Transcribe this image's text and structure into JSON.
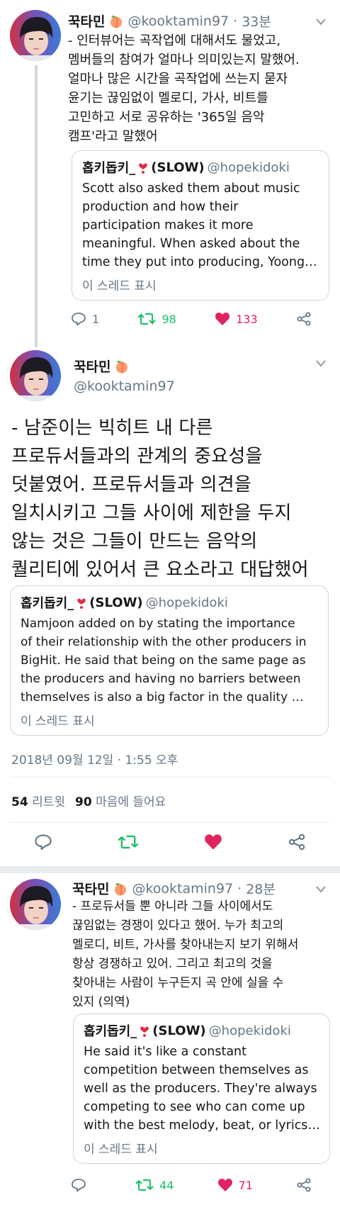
{
  "tweets": [
    {
      "name": "꾹타민",
      "handle": "@kooktamin97",
      "time": "33분",
      "text": "- 인터뷰어는 곡작업에 대해서도 물었고,\n멤버들의 참여가 얼마나 의미있는지 말했어.\n얼마나 많은 시간을 곡작업에 쓰는지 묻자\n윤기는 끊임없이 멜로디, 가사, 비트를\n고민하고 서로 공유하는 '365일 음악\n캠프'라고 말했어",
      "quote": {
        "name": "홉키돕키_",
        "name_suffix": "(SLOW)",
        "handle": "@hopekidoki",
        "lines": [
          "Scott also asked them about music",
          "production and how their",
          "participation makes it more",
          "meaningful. When asked about the",
          "time they put into producing, Yoongi…"
        ],
        "link": "이 스레드 표시"
      },
      "replies": "1",
      "retweets": "98",
      "likes": "133"
    },
    {
      "name": "꾹타민",
      "handle": "@kooktamin97",
      "text": "- 남준이는 빅히트 내 다른\n프로듀서들과의 관계의 중요성을\n덧붙였어. 프로듀서들과 의견을\n일치시키고 그들 사이에 제한을 두지\n않는 것은 그들이 만드는 음악의\n퀄리티에 있어서 큰 요소라고 대답했어",
      "quote": {
        "name": "홉키돕키_",
        "name_suffix": "(SLOW)",
        "handle": "@hopekidoki",
        "lines": [
          "Namjoon added on by stating the importance",
          "of their relationship with the other producers in",
          "BigHit. He said that being on the same page as",
          "the producers and having no barriers between",
          "themselves is also a big factor in the quality …"
        ],
        "link": "이 스레드 표시"
      },
      "timestamp": "2018년 09월 12일 · 1:55 오후",
      "retweet_count": "54",
      "retweet_label": "리트윗",
      "like_count": "90",
      "like_label": "마음에 들어요"
    },
    {
      "name": "꾹타민",
      "handle": "@kooktamin97",
      "time": "28분",
      "text": "- 프로듀서들 뿐 아니라 그들 사이에서도\n끊임없는 경쟁이 있다고 했어. 누가 최고의\n멜로디, 비트, 가사를 찾아내는지 보기 위해서\n항상 경쟁하고 있어. 그리고 최고의 것을\n찾아내는 사람이 누구든지 곡 안에 실을 수\n있지 (의역)",
      "quote": {
        "name": "홉키돕키_",
        "name_suffix": "(SLOW)",
        "handle": "@hopekidoki",
        "lines": [
          "He said it's like a constant",
          "competition between themselves as",
          "well as the producers. They're always",
          "competing to see who can come up",
          "with the best melody, beat, or lyrics,…"
        ],
        "link": "이 스레드 표시"
      },
      "replies": "",
      "retweets": "44",
      "likes": "71"
    }
  ],
  "colors": {
    "retweet": "#17bf63",
    "like": "#e0245e",
    "muted": "#657786",
    "border": "#ccd6dd"
  },
  "icons": [
    "reply-icon",
    "retweet-icon",
    "heart-icon",
    "share-icon",
    "chevron-down-icon",
    "peach-emoji-icon",
    "red-heart-emoji-icon"
  ]
}
